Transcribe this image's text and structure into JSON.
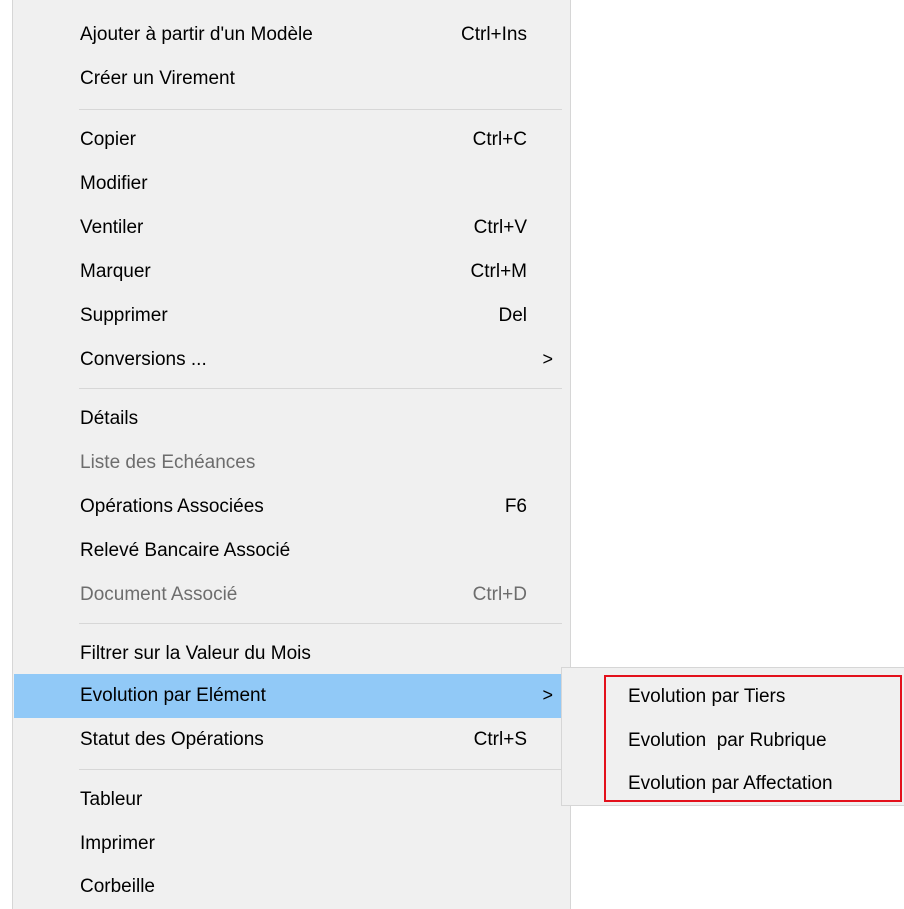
{
  "menu": {
    "items": [
      {
        "label": "Ajouter à partir d'un Modèle",
        "shortcut": "Ctrl+Ins"
      },
      {
        "label": "Créer un Virement",
        "shortcut": ""
      },
      {
        "label": "Copier",
        "shortcut": "Ctrl+C"
      },
      {
        "label": "Modifier",
        "shortcut": ""
      },
      {
        "label": "Ventiler",
        "shortcut": "Ctrl+V"
      },
      {
        "label": "Marquer",
        "shortcut": "Ctrl+M"
      },
      {
        "label": "Supprimer",
        "shortcut": "Del"
      },
      {
        "label": "Conversions ...",
        "shortcut": ""
      },
      {
        "label": "Détails",
        "shortcut": ""
      },
      {
        "label": "Liste des Echéances",
        "shortcut": ""
      },
      {
        "label": "Opérations Associées",
        "shortcut": "F6"
      },
      {
        "label": "Relevé Bancaire Associé",
        "shortcut": ""
      },
      {
        "label": "Document Associé",
        "shortcut": "Ctrl+D"
      },
      {
        "label": "Filtrer sur la Valeur du Mois",
        "shortcut": ""
      },
      {
        "label": "Evolution par Elément",
        "shortcut": ""
      },
      {
        "label": "Statut des Opérations",
        "shortcut": "Ctrl+S"
      },
      {
        "label": "Tableur",
        "shortcut": ""
      },
      {
        "label": "Imprimer",
        "shortcut": ""
      },
      {
        "label": "Corbeille",
        "shortcut": ""
      }
    ],
    "submenu_arrow": ">"
  },
  "submenu": {
    "items": [
      {
        "label": "Evolution par Tiers"
      },
      {
        "label": "Evolution  par Rubrique"
      },
      {
        "label": "Evolution par Affectation"
      }
    ]
  },
  "colors": {
    "highlight": "#91c9f7",
    "disabled_text": "#6d6d6d",
    "annotation_border": "#e3101b"
  },
  "icons": {
    "submenu_arrow": "chevron-right-icon"
  }
}
